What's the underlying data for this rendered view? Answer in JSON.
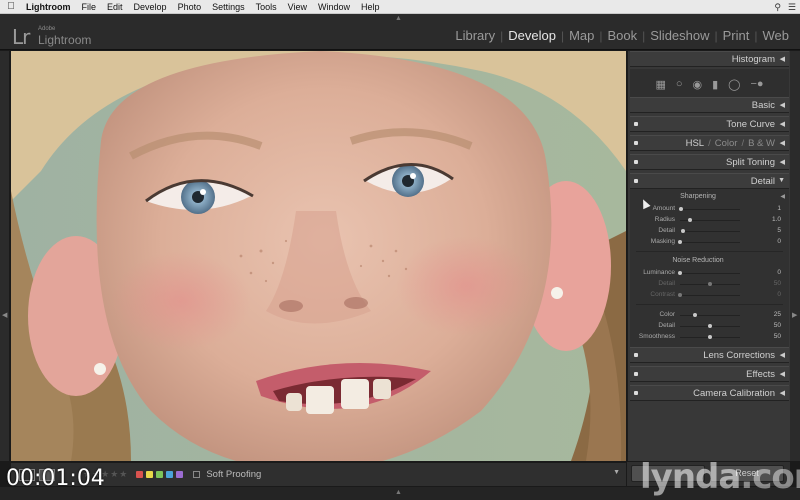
{
  "menubar": {
    "app": "Lightroom",
    "items": [
      "File",
      "Edit",
      "Develop",
      "Photo",
      "Settings",
      "Tools",
      "View",
      "Window",
      "Help"
    ]
  },
  "identity": {
    "logo": "Lr",
    "brand_small": "Adobe",
    "brand_name": "Lightroom"
  },
  "modules": [
    {
      "label": "Library",
      "active": false
    },
    {
      "label": "Develop",
      "active": true
    },
    {
      "label": "Map",
      "active": false
    },
    {
      "label": "Book",
      "active": false
    },
    {
      "label": "Slideshow",
      "active": false
    },
    {
      "label": "Print",
      "active": false
    },
    {
      "label": "Web",
      "active": false
    }
  ],
  "panels": {
    "histogram": "Histogram",
    "basic": "Basic",
    "tone_curve": "Tone Curve",
    "hsl": {
      "a": "HSL",
      "b": "Color",
      "c": "B & W"
    },
    "split_toning": "Split Toning",
    "detail": "Detail",
    "lens_corrections": "Lens Corrections",
    "effects": "Effects",
    "camera_calibration": "Camera Calibration"
  },
  "detail": {
    "sharpening": {
      "title": "Sharpening",
      "rows": [
        {
          "label": "Amount",
          "value": "1",
          "fraction": 0.01
        },
        {
          "label": "Radius",
          "value": "1.0",
          "fraction": 0.17
        },
        {
          "label": "Detail",
          "value": "5",
          "fraction": 0.05
        },
        {
          "label": "Masking",
          "value": "0",
          "fraction": 0.0
        }
      ]
    },
    "noise_reduction": {
      "title": "Noise Reduction",
      "rows": [
        {
          "label": "Luminance",
          "value": "0",
          "fraction": 0.0,
          "dim": false
        },
        {
          "label": "Detail",
          "value": "50",
          "fraction": 0.5,
          "dim": true
        },
        {
          "label": "Contrast",
          "value": "0",
          "fraction": 0.0,
          "dim": true
        }
      ],
      "color_rows": [
        {
          "label": "Color",
          "value": "25",
          "fraction": 0.25
        },
        {
          "label": "Detail",
          "value": "50",
          "fraction": 0.5
        },
        {
          "label": "Smoothness",
          "value": "50",
          "fraction": 0.5
        }
      ]
    }
  },
  "toolbar": {
    "soft_proofing": "Soft Proofing",
    "flag_colors": [
      "#d9534f",
      "#e8d84a",
      "#7dc45a",
      "#4aa3d9",
      "#9b6cd1"
    ]
  },
  "panel_bottom": {
    "reset": "Reset"
  },
  "overlay": {
    "timecode": "00:01:04",
    "watermark": "lynda",
    "watermark_suffix": ".com"
  }
}
